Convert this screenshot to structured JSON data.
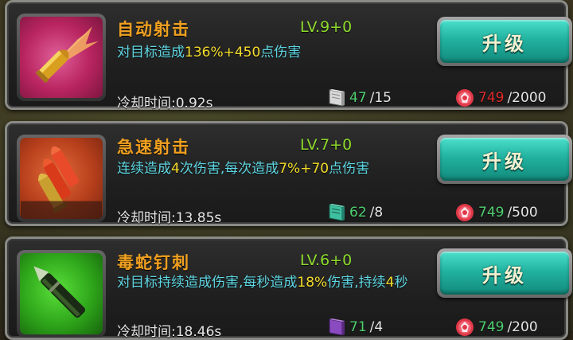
{
  "skills": [
    {
      "name": "自动射击",
      "level": "LV.9+0",
      "desc_parts": [
        "对目标造成",
        "136%",
        "+",
        "450",
        "点伤害"
      ],
      "cooldown": "冷却时间:0.92s",
      "book_current": "47",
      "book_required": "/15",
      "gem_current": "749",
      "gem_required": "/2000",
      "button": "升级",
      "icon": "bullet-icon"
    },
    {
      "name": "急速射击",
      "level": "LV.7+0",
      "desc_parts": [
        "连续造成",
        "4",
        "次伤害,每次造成",
        "7%",
        "+",
        "70",
        "点伤害"
      ],
      "cooldown": "冷却时间:13.85s",
      "book_current": "62",
      "book_required": "/8",
      "gem_current": "749",
      "gem_required": "/500",
      "button": "升级",
      "icon": "bullets-icon"
    },
    {
      "name": "毒蛇钉刺",
      "level": "LV.6+0",
      "desc_parts": [
        "对目标持续造成伤害,每秒造成",
        "18%",
        "伤害,持续",
        "4",
        "秒"
      ],
      "cooldown": "冷却时间:18.46s",
      "book_current": "71",
      "book_required": "/4",
      "gem_current": "749",
      "gem_required": "/200",
      "button": "升级",
      "icon": "poison-dart-icon"
    }
  ],
  "colors": {
    "name": "#f0a020",
    "level": "#8edc2c",
    "desc": "#5fd6e2",
    "highlight": "#f4dc2a",
    "button": "#22b2a0",
    "insufficient": "#e02a2a",
    "sufficient": "#4fd070"
  }
}
